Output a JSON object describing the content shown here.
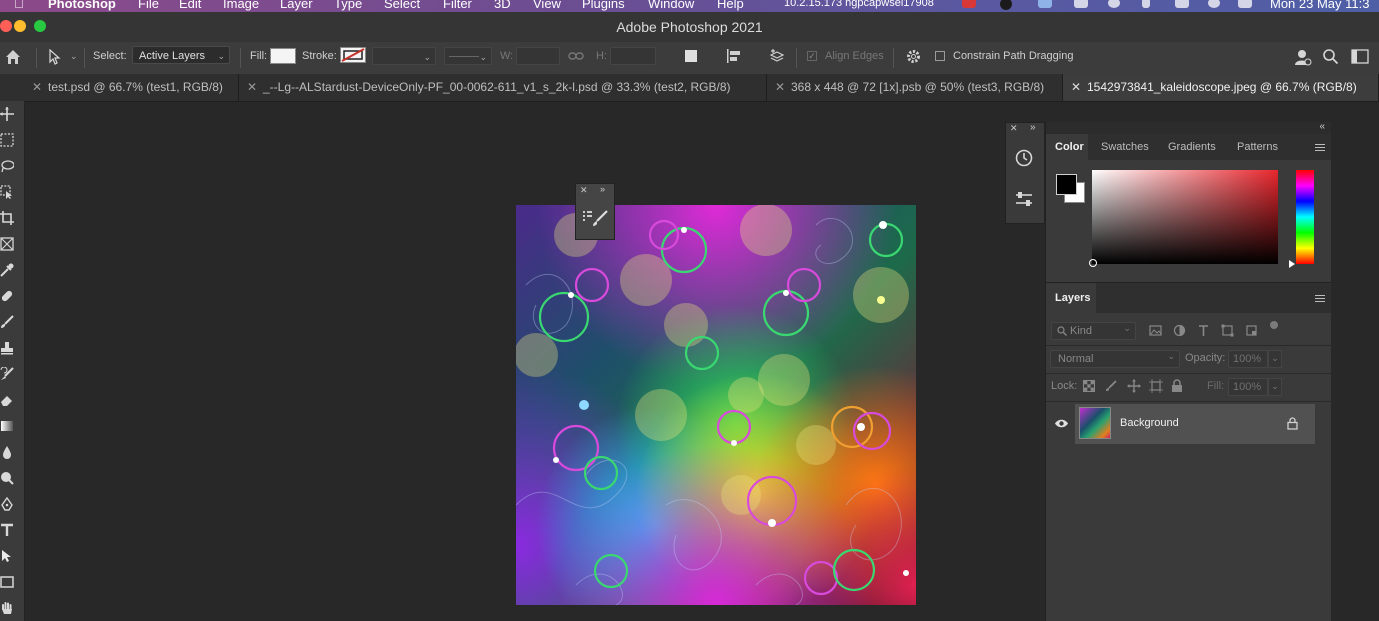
{
  "menubar": {
    "app_name": "Photoshop",
    "items": [
      "File",
      "Edit",
      "Image",
      "Layer",
      "Type",
      "Select",
      "Filter",
      "3D",
      "View",
      "Plugins",
      "Window",
      "Help"
    ],
    "status_ip": "10.2.15.173 hgpcapwsel17908",
    "clock": "Mon 23 May  11:3"
  },
  "titlebar": {
    "title": "Adobe Photoshop 2021"
  },
  "options": {
    "select_label": "Select:",
    "select_value": "Active Layers",
    "fill_label": "Fill:",
    "stroke_label": "Stroke:",
    "w_label": "W:",
    "h_label": "H:",
    "align_edges_label": "Align Edges",
    "constrain_label": "Constrain Path Dragging"
  },
  "tabs": [
    {
      "label": "test.psd @ 66.7% (test1, RGB/8)",
      "active": false
    },
    {
      "label": "_--Lg--ALStardust-DeviceOnly-PF_00-0062-611_v1_s_2k-l.psd @ 33.3% (test2, RGB/8)",
      "active": false
    },
    {
      "label": "368 x 448 @ 72 [1x].psb @ 50% (test3, RGB/8)",
      "active": false
    },
    {
      "label": "1542973841_kaleidoscope.jpeg @ 66.7% (RGB/8)",
      "active": true
    }
  ],
  "color_panel": {
    "tabs": [
      "Color",
      "Swatches",
      "Gradients",
      "Patterns"
    ],
    "foreground": "#000000",
    "background": "#ffffff",
    "hue_color": "#e8262d"
  },
  "layers_panel": {
    "tab": "Layers",
    "filter_placeholder": "Kind",
    "blend_mode": "Normal",
    "opacity_label": "Opacity:",
    "opacity_value": "100%",
    "lock_label": "Lock:",
    "fill_label": "Fill:",
    "fill_value": "100%",
    "layers": [
      {
        "name": "Background",
        "visible": true,
        "locked": true
      }
    ]
  },
  "colors": {
    "accent_red": "#c8332b"
  }
}
